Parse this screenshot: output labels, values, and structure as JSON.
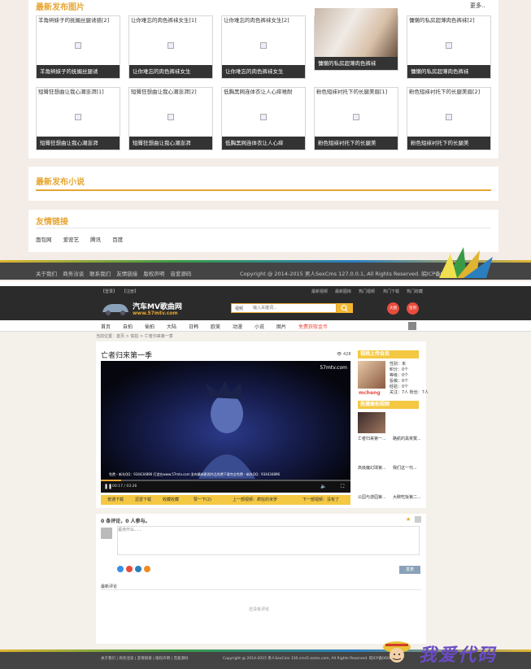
{
  "top": {
    "latest_images_title": "最新发布图片",
    "more_label": "更多..",
    "row1": [
      {
        "title": "羊角辫妹子的抚媚丝腿诱惑[2]",
        "caption": "羊角辫妹子的抚媚丝腿诱"
      },
      {
        "title": "让你难忘的肉色裤袜女生[1]",
        "caption": "让你难忘的肉色裤袜女生"
      },
      {
        "title": "让你难忘的肉色裤袜女生[2]",
        "caption": "让你难忘的肉色裤袜女生"
      },
      {
        "title": "",
        "caption": "慵懒的私房超薄肉色裤袜"
      },
      {
        "title": "慵懒的私房超薄肉色裤袜[2]",
        "caption": "慵懒的私房超薄肉色裤袜"
      }
    ],
    "row2": [
      {
        "title": "短臀狂想曲让我心潮澎湃[1]",
        "caption": "短臀狂想曲让我心潮澎湃"
      },
      {
        "title": "短臀狂想曲让我心潮澎湃[2]",
        "caption": "短臀狂想曲让我心潮澎湃"
      },
      {
        "title": "低胸黑网连体衣让人心痒难耐",
        "caption": "低胸黑网连体衣让人心痒"
      },
      {
        "title": "粉色短袜衬托下的长腿美眉[1]",
        "caption": "粉色短袜衬托下的长腿美"
      },
      {
        "title": "粉色短袜衬托下的长腿美眉[2]",
        "caption": "粉色短袜衬托下的长腿美"
      }
    ],
    "latest_novels_title": "最新发布小说",
    "friend_links_title": "友情链接",
    "friend_links": [
      "面包网",
      "爱密艺",
      "腾讯",
      "百度"
    ],
    "footer_links": [
      "关于我们",
      "商务洽谈",
      "联系我们",
      "友情链接",
      "版权声明",
      "音爱源码"
    ],
    "copyright": "Copyright @ 2014-2015 男人SexCms 127.0.0.1, All Rights Reserved. 皖ICP备0600107"
  },
  "bottom": {
    "topbar_left": [
      "【登录】",
      "【注册】"
    ],
    "topbar_right": [
      "最新视频",
      "最新图库",
      "热门视频",
      "热门下载",
      "热门收藏"
    ],
    "logo_title": "汽车MV歌曲网",
    "logo_url": "www.57mtv.com",
    "search_scope": "视频",
    "search_placeholder": "输入关键词...",
    "badge_1": "大图",
    "badge_2": "签到",
    "nav": [
      "首页",
      "自拍",
      "偷拍",
      "大陆",
      "日韩",
      "欧美",
      "动漫",
      "小说",
      "图片",
      "免费获取金币"
    ],
    "breadcrumb": "当前位置：首页 > 偷拍 > 亡者归来第一季",
    "video_title": "亡者归来第一季",
    "view_count": "428",
    "watermark": "57mtv.com",
    "subtitle_line": "免费・新东QQ：934434896  打造在www.57mtv.com  发布最新影视作品免费下载完全免费・新东QQ：934434896",
    "time": "00:17 / 03:26",
    "buttons": [
      "普通下载",
      "迅雷下载",
      "收藏收藏",
      "赞一下(2)",
      "上一部视频：疯狂的米罗",
      "下一部视频：没有了"
    ],
    "uploader_title": "视频上传会员",
    "uploader_name": "mcheng",
    "uploader_stats": [
      "性别：未",
      "积分：0个",
      "等级：0个",
      "投稿：0个",
      "经验：0个",
      "关注：7人  粉丝：7人"
    ],
    "hot_title": "热播偷拍视频",
    "hot_items": [
      "亡者归来第一...",
      "路航的黑夜寞...",
      "高级魔幻球第...",
      "我们这一代...",
      "公园与游园第...",
      "大碗吃饭第二..."
    ],
    "comment_count_text": "0 条评论，0 人参与。",
    "comment_placeholder": "说点什么...",
    "publish": "发表",
    "latest_comments": "最新评论",
    "no_comments": "还没有评论",
    "footer_copy": "Copyright @ 2014-2015 男人SexCms 130.cms5.eoms.com, All Rights Reserved. 皖ICP备0600107"
  },
  "watermark_text": "我爱代码"
}
